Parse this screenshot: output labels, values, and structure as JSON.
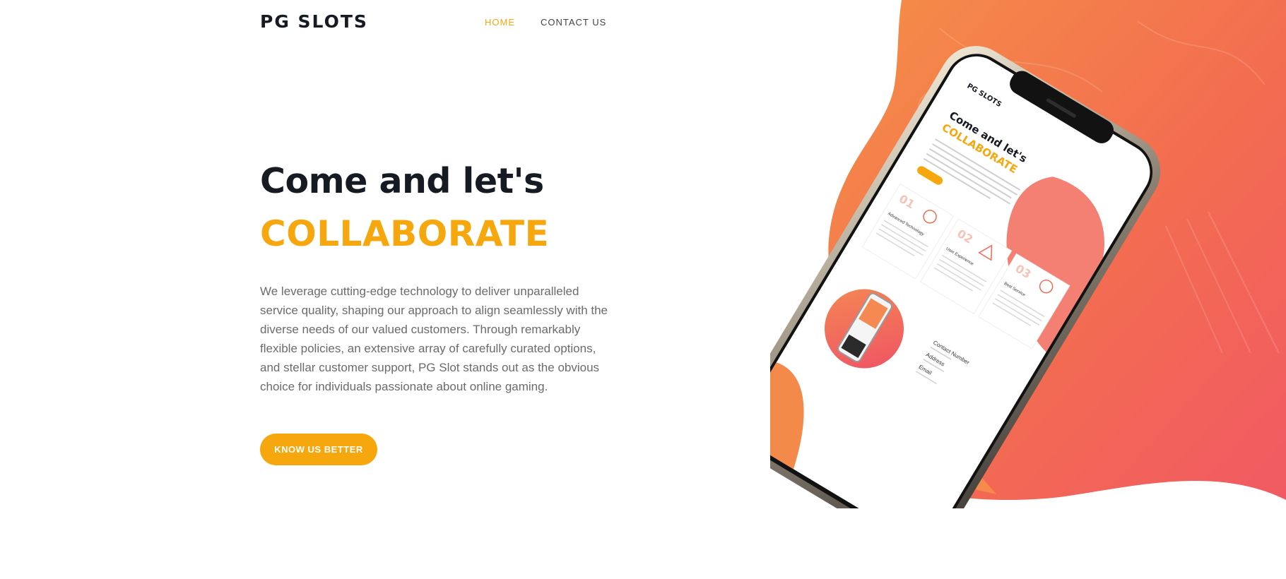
{
  "nav": {
    "logo": "PG SLOTS",
    "links": [
      {
        "label": "HOME",
        "active": true
      },
      {
        "label": "CONTACT US",
        "active": false
      }
    ]
  },
  "hero": {
    "title": "Come and let's",
    "highlight": "COLLABORATE",
    "description": "We leverage cutting-edge technology to deliver unparalleled service quality, shaping our approach to align seamlessly with the diverse needs of our valued customers. Through remarkably flexible policies, an extensive array of carefully curated options, and stellar customer support, PG Slot stands out as the obvious choice for individuals passionate about online gaming.",
    "cta_label": "KNOW US BETTER"
  },
  "phone_screen": {
    "logo": "PG SLOTS",
    "title": "Come and let's",
    "highlight": "COLLABORATE",
    "features": [
      {
        "number": "01",
        "label": "Advanced Technology"
      },
      {
        "number": "02",
        "label": "User Experience"
      },
      {
        "number": "03",
        "label": "Best Service"
      }
    ],
    "contact_items": [
      "Contact Number",
      "Address",
      "Email"
    ]
  },
  "colors": {
    "accent": "#f7a70e",
    "dark": "#161a22",
    "blob_start": "#f48f47",
    "blob_end": "#f15a63"
  }
}
